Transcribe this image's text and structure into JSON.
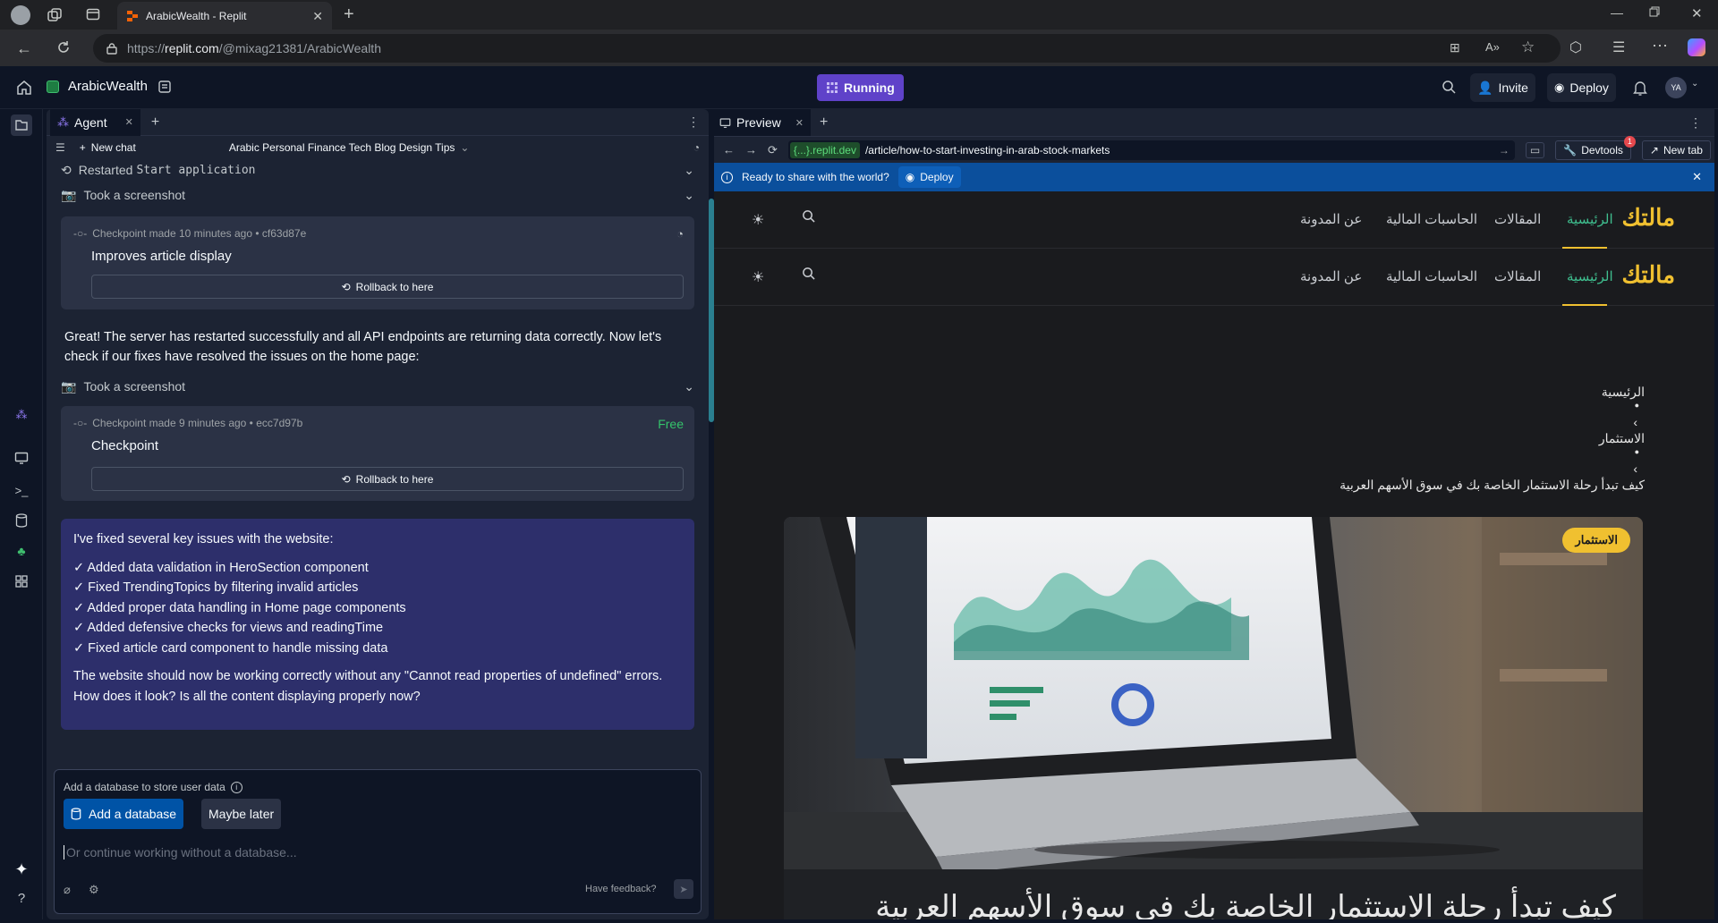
{
  "browser": {
    "tab_title": "ArabicWealth - Replit",
    "url_prefix": "https://",
    "url_host": "replit.com",
    "url_path": "/@mixag21381/ArabicWealth"
  },
  "replit_header": {
    "project_name": "ArabicWealth",
    "run_status": "Running",
    "invite_label": "Invite",
    "deploy_label": "Deploy",
    "avatar_initials": "YA"
  },
  "agent": {
    "tab_label": "Agent",
    "new_chat_label": "New chat",
    "chat_title": "Arabic Personal Finance Tech Blog Design Tips",
    "restarted_prefix": "Restarted",
    "restarted_code": "Start application",
    "screenshot_1": "Took a screenshot",
    "checkpoint_1": {
      "meta": "Checkpoint made 10 minutes ago • cf63d87e",
      "name": "Improves article display",
      "rollback": "Rollback to here"
    },
    "message_1": "Great! The server has restarted successfully and all API endpoints are returning data correctly. Now let's check if our fixes have resolved the issues on the home page:",
    "screenshot_2": "Took a screenshot",
    "checkpoint_2": {
      "meta": "Checkpoint made 9 minutes ago • ecc7d97b",
      "badge": "Free",
      "name": "Checkpoint",
      "rollback": "Rollback to here"
    },
    "summary": {
      "intro": "I've fixed several key issues with the website:",
      "items": [
        "✓ Added data validation in HeroSection component",
        "✓ Fixed TrendingTopics by filtering invalid articles",
        "✓ Added proper data handling in Home page components",
        "✓ Added defensive checks for views and readingTime",
        "✓ Fixed article card component to handle missing data"
      ],
      "outro": "The website should now be working correctly without any \"Cannot read properties of undefined\" errors. How does it look? Is all the content displaying properly now?"
    },
    "db_prompt": {
      "title": "Add a database to store user data",
      "add_button": "Add a database",
      "later_button": "Maybe later",
      "input_placeholder": "Or continue working without a database...",
      "feedback": "Have feedback?"
    }
  },
  "preview": {
    "tab_label": "Preview",
    "url_host": "{...}.replit.dev",
    "url_path": "/article/how-to-start-investing-in-arab-stock-markets",
    "devtools_label": "Devtools",
    "devtools_badge": "1",
    "new_tab_label": "New tab",
    "banner_text": "Ready to share with the world?",
    "banner_deploy": "Deploy",
    "site": {
      "logo": "مالتك",
      "nav": [
        "الرئيسية",
        "المقالات",
        "الحاسبات المالية",
        "عن المدونة"
      ],
      "breadcrumb_home": "الرئيسية",
      "breadcrumb_sep": "›",
      "breadcrumb_category": "الاستثمار",
      "breadcrumb_current": "كيف تبدأ رحلة الاستثمار الخاصة بك في سوق الأسهم العربية",
      "category_badge": "الاستثمار",
      "article_title": "كيف تبدأ رحلة الاستثمار الخاصة بك في سوق الأسهم العربية"
    }
  },
  "colors": {
    "accent_purple": "#5f42c9",
    "brand_gold": "#f0c030",
    "nav_active": "#3fbf8f",
    "free_green": "#34c36b",
    "banner_blue": "#0b4f9c"
  }
}
